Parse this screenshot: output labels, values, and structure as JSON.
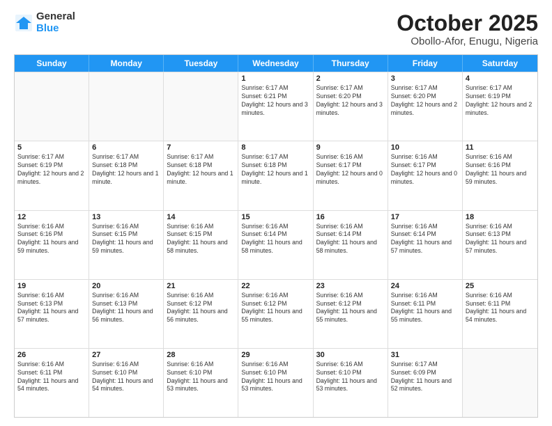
{
  "header": {
    "logo_general": "General",
    "logo_blue": "Blue",
    "title": "October 2025",
    "location": "Obollo-Afor, Enugu, Nigeria"
  },
  "days_of_week": [
    "Sunday",
    "Monday",
    "Tuesday",
    "Wednesday",
    "Thursday",
    "Friday",
    "Saturday"
  ],
  "weeks": [
    [
      {
        "day": "",
        "info": ""
      },
      {
        "day": "",
        "info": ""
      },
      {
        "day": "",
        "info": ""
      },
      {
        "day": "1",
        "info": "Sunrise: 6:17 AM\nSunset: 6:21 PM\nDaylight: 12 hours\nand 3 minutes."
      },
      {
        "day": "2",
        "info": "Sunrise: 6:17 AM\nSunset: 6:20 PM\nDaylight: 12 hours\nand 3 minutes."
      },
      {
        "day": "3",
        "info": "Sunrise: 6:17 AM\nSunset: 6:20 PM\nDaylight: 12 hours\nand 2 minutes."
      },
      {
        "day": "4",
        "info": "Sunrise: 6:17 AM\nSunset: 6:19 PM\nDaylight: 12 hours\nand 2 minutes."
      }
    ],
    [
      {
        "day": "5",
        "info": "Sunrise: 6:17 AM\nSunset: 6:19 PM\nDaylight: 12 hours\nand 2 minutes."
      },
      {
        "day": "6",
        "info": "Sunrise: 6:17 AM\nSunset: 6:18 PM\nDaylight: 12 hours\nand 1 minute."
      },
      {
        "day": "7",
        "info": "Sunrise: 6:17 AM\nSunset: 6:18 PM\nDaylight: 12 hours\nand 1 minute."
      },
      {
        "day": "8",
        "info": "Sunrise: 6:17 AM\nSunset: 6:18 PM\nDaylight: 12 hours\nand 1 minute."
      },
      {
        "day": "9",
        "info": "Sunrise: 6:16 AM\nSunset: 6:17 PM\nDaylight: 12 hours\nand 0 minutes."
      },
      {
        "day": "10",
        "info": "Sunrise: 6:16 AM\nSunset: 6:17 PM\nDaylight: 12 hours\nand 0 minutes."
      },
      {
        "day": "11",
        "info": "Sunrise: 6:16 AM\nSunset: 6:16 PM\nDaylight: 11 hours\nand 59 minutes."
      }
    ],
    [
      {
        "day": "12",
        "info": "Sunrise: 6:16 AM\nSunset: 6:16 PM\nDaylight: 11 hours\nand 59 minutes."
      },
      {
        "day": "13",
        "info": "Sunrise: 6:16 AM\nSunset: 6:15 PM\nDaylight: 11 hours\nand 59 minutes."
      },
      {
        "day": "14",
        "info": "Sunrise: 6:16 AM\nSunset: 6:15 PM\nDaylight: 11 hours\nand 58 minutes."
      },
      {
        "day": "15",
        "info": "Sunrise: 6:16 AM\nSunset: 6:14 PM\nDaylight: 11 hours\nand 58 minutes."
      },
      {
        "day": "16",
        "info": "Sunrise: 6:16 AM\nSunset: 6:14 PM\nDaylight: 11 hours\nand 58 minutes."
      },
      {
        "day": "17",
        "info": "Sunrise: 6:16 AM\nSunset: 6:14 PM\nDaylight: 11 hours\nand 57 minutes."
      },
      {
        "day": "18",
        "info": "Sunrise: 6:16 AM\nSunset: 6:13 PM\nDaylight: 11 hours\nand 57 minutes."
      }
    ],
    [
      {
        "day": "19",
        "info": "Sunrise: 6:16 AM\nSunset: 6:13 PM\nDaylight: 11 hours\nand 57 minutes."
      },
      {
        "day": "20",
        "info": "Sunrise: 6:16 AM\nSunset: 6:13 PM\nDaylight: 11 hours\nand 56 minutes."
      },
      {
        "day": "21",
        "info": "Sunrise: 6:16 AM\nSunset: 6:12 PM\nDaylight: 11 hours\nand 56 minutes."
      },
      {
        "day": "22",
        "info": "Sunrise: 6:16 AM\nSunset: 6:12 PM\nDaylight: 11 hours\nand 55 minutes."
      },
      {
        "day": "23",
        "info": "Sunrise: 6:16 AM\nSunset: 6:12 PM\nDaylight: 11 hours\nand 55 minutes."
      },
      {
        "day": "24",
        "info": "Sunrise: 6:16 AM\nSunset: 6:11 PM\nDaylight: 11 hours\nand 55 minutes."
      },
      {
        "day": "25",
        "info": "Sunrise: 6:16 AM\nSunset: 6:11 PM\nDaylight: 11 hours\nand 54 minutes."
      }
    ],
    [
      {
        "day": "26",
        "info": "Sunrise: 6:16 AM\nSunset: 6:11 PM\nDaylight: 11 hours\nand 54 minutes."
      },
      {
        "day": "27",
        "info": "Sunrise: 6:16 AM\nSunset: 6:10 PM\nDaylight: 11 hours\nand 54 minutes."
      },
      {
        "day": "28",
        "info": "Sunrise: 6:16 AM\nSunset: 6:10 PM\nDaylight: 11 hours\nand 53 minutes."
      },
      {
        "day": "29",
        "info": "Sunrise: 6:16 AM\nSunset: 6:10 PM\nDaylight: 11 hours\nand 53 minutes."
      },
      {
        "day": "30",
        "info": "Sunrise: 6:16 AM\nSunset: 6:10 PM\nDaylight: 11 hours\nand 53 minutes."
      },
      {
        "day": "31",
        "info": "Sunrise: 6:17 AM\nSunset: 6:09 PM\nDaylight: 11 hours\nand 52 minutes."
      },
      {
        "day": "",
        "info": ""
      }
    ]
  ]
}
